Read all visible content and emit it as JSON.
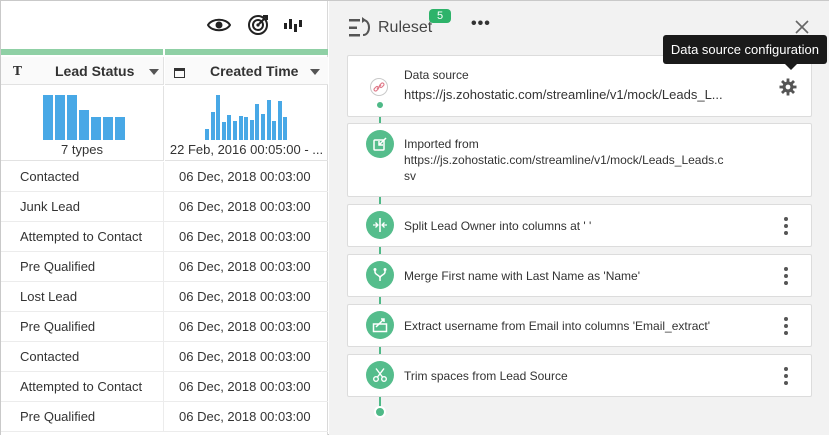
{
  "toolbar": {
    "icons": [
      "eye-icon",
      "target-icon",
      "chart-bars-icon"
    ]
  },
  "columns": [
    {
      "type_glyph": "T",
      "name": "Lead Status",
      "summary": "7 types"
    },
    {
      "type_glyph": "calendar",
      "name": "Created Time",
      "summary": "22 Feb, 2016 00:05:00 - ..."
    }
  ],
  "histograms": {
    "lead_status": [
      0.9,
      0.9,
      0.9,
      0.6,
      0.45,
      0.45,
      0.45
    ],
    "created_time": [
      0.22,
      0.55,
      0.9,
      0.35,
      0.5,
      0.38,
      0.48,
      0.45,
      0.4,
      0.72,
      0.52,
      0.8,
      0.38,
      0.78,
      0.45
    ]
  },
  "rows": [
    {
      "status": "Contacted",
      "created": "06 Dec, 2018 00:03:00"
    },
    {
      "status": "Junk Lead",
      "created": "06 Dec, 2018 00:03:00"
    },
    {
      "status": "Attempted to Contact",
      "created": "06 Dec, 2018 00:03:00"
    },
    {
      "status": "Pre Qualified",
      "created": "06 Dec, 2018 00:03:00"
    },
    {
      "status": "Lost Lead",
      "created": "06 Dec, 2018 00:03:00"
    },
    {
      "status": "Pre Qualified",
      "created": "06 Dec, 2018 00:03:00"
    },
    {
      "status": "Contacted",
      "created": "06 Dec, 2018 00:03:00"
    },
    {
      "status": "Attempted to Contact",
      "created": "06 Dec, 2018 00:03:00"
    },
    {
      "status": "Pre Qualified",
      "created": "06 Dec, 2018 00:03:00"
    }
  ],
  "ruleset": {
    "title": "Ruleset",
    "badge": "5",
    "more": "•••",
    "tooltip": "Data source configuration",
    "datasource": {
      "title": "Data source",
      "url": "https://js.zohostatic.com/streamline/v1/mock/Leads_L..."
    },
    "steps": [
      {
        "icon": "import-icon",
        "label": "Imported from",
        "sub": "https://js.zohostatic.com/streamline/v1/mock/Leads_Leads.c",
        "sub2": "sv"
      },
      {
        "icon": "split-icon",
        "label": "Split Lead Owner into columns at ' '"
      },
      {
        "icon": "merge-icon",
        "label": "Merge First name with Last Name as 'Name'"
      },
      {
        "icon": "extract-icon",
        "label": "Extract username from Email into columns 'Email_extract'"
      },
      {
        "icon": "trim-icon",
        "label": "Trim spaces from Lead Source"
      }
    ]
  },
  "colors": {
    "accent_green": "#4eb987",
    "bar_blue": "#48a8e6",
    "badge_green": "#2eb36a"
  }
}
